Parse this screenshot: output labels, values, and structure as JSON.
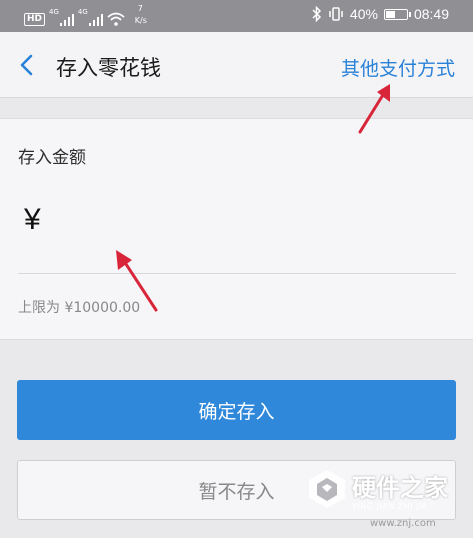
{
  "status_bar": {
    "hd": "HD",
    "net_type_1": "4G",
    "net_type_2": "4G",
    "speed_value": "7",
    "speed_unit": "K/s",
    "battery_percent_text": "40%",
    "battery_level": 0.4,
    "time": "08:49"
  },
  "header": {
    "back_icon": "chevron-left-icon",
    "title": "存入零花钱",
    "other_payment": "其他支付方式"
  },
  "amount_section": {
    "label": "存入金额",
    "currency_symbol": "¥",
    "amount_value": "",
    "limit_text": "上限为 ¥10000.00"
  },
  "buttons": {
    "confirm": "确定存入",
    "cancel": "暂不存入"
  },
  "annotations": {
    "arrow_color": "#d9253a"
  },
  "watermark": {
    "name": "硬件之家",
    "pinyin": "YING JIAN ZHI JIA",
    "url": "www.znj.com"
  },
  "colors": {
    "accent": "#2f88d9",
    "link": "#2a82d8",
    "status_bar": "#8f8f94"
  }
}
